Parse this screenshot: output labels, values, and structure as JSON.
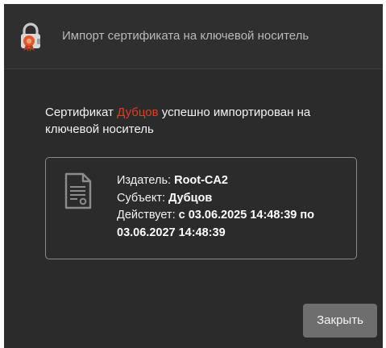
{
  "dialog": {
    "title": "Импорт сертификата на ключевой носитель",
    "app_icon": "lock-certificate-icon"
  },
  "message": {
    "prefix": "Сертификат ",
    "subject_name": "Дубцов",
    "suffix": " успешно импортирован на ключевой носитель"
  },
  "certificate": {
    "icon": "document-certificate-icon",
    "issuer_label": "Издатель:",
    "issuer_value": "Root-CA2",
    "subject_label": "Субъект:",
    "subject_value": "Дубцов",
    "valid_label": "Действует:",
    "valid_value": "с 03.06.2025 14:48:39 по 03.06.2027 14:48:39"
  },
  "buttons": {
    "close_label": "Закрыть"
  },
  "colors": {
    "background": "#2b2b2b",
    "accent_name": "#d9401f",
    "button": "#6e6e6e"
  }
}
